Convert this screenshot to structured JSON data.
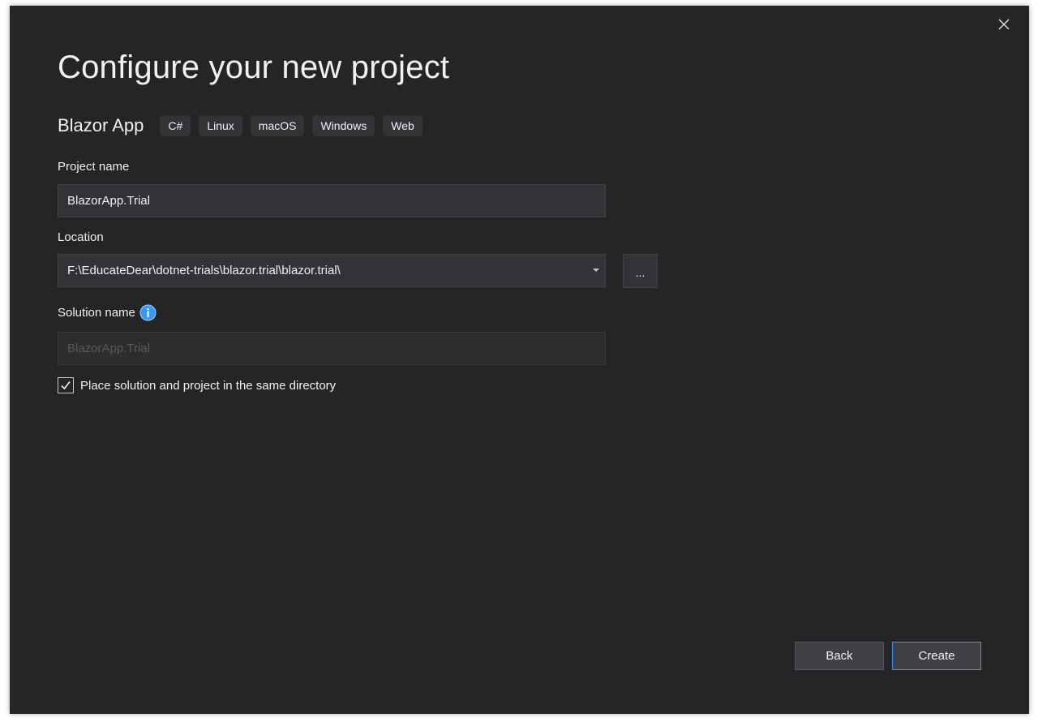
{
  "dialog": {
    "title": "Configure your new project",
    "close_icon": "close-icon"
  },
  "template": {
    "name": "Blazor App",
    "tags": [
      "C#",
      "Linux",
      "macOS",
      "Windows",
      "Web"
    ]
  },
  "project_name": {
    "label": "Project name",
    "value": "BlazorApp.Trial"
  },
  "location": {
    "label": "Location",
    "value": "F:\\EducateDear\\dotnet-trials\\blazor.trial\\blazor.trial\\",
    "browse_label": "...",
    "dropdown_icon": "chevron-down-icon"
  },
  "solution_name": {
    "label": "Solution name",
    "placeholder": "BlazorApp.Trial",
    "info_icon": "info-icon",
    "info_color": "#3399ff"
  },
  "same_directory": {
    "label": "Place solution and project in the same directory",
    "checked": true
  },
  "buttons": {
    "back": "Back",
    "create": "Create"
  },
  "colors": {
    "background": "#252526",
    "input_background": "#333337",
    "accent": "#3399ff",
    "text": "#f1f1f1"
  }
}
